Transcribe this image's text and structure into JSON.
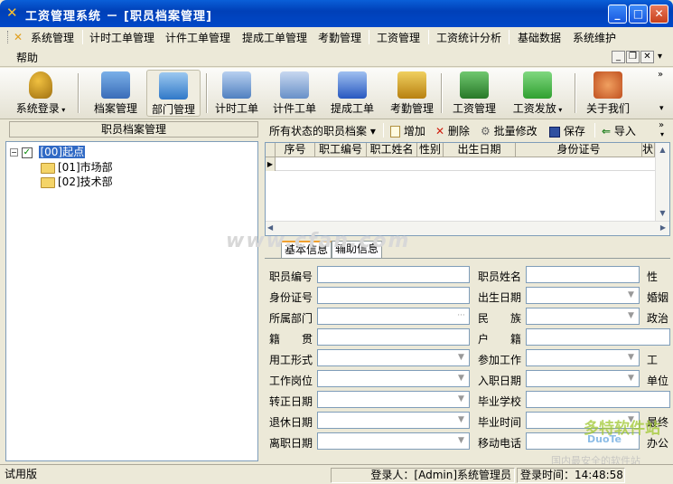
{
  "window": {
    "title": "工资管理系统 － [职员档案管理]"
  },
  "menu": [
    "系统管理",
    "计时工单管理",
    "计件工单管理",
    "提成工单管理",
    "考勤管理",
    "工资管理",
    "工资统计分析",
    "基础数据",
    "系统维护"
  ],
  "menu2": {
    "help": "帮助"
  },
  "toolbar": [
    "系统登录",
    "档案管理",
    "部门管理",
    "计时工单",
    "计件工单",
    "提成工单",
    "考勤管理",
    "工资管理",
    "工资发放",
    "关于我们"
  ],
  "left": {
    "header": "职员档案管理",
    "tree": [
      "[00]起点",
      "[01]市场部",
      "[02]技术部"
    ]
  },
  "right_toolbar": {
    "filter": "所有状态的职员档案",
    "add": "增加",
    "delete": "删除",
    "batch": "批量修改",
    "save": "保存",
    "import": "导入"
  },
  "grid": {
    "columns": [
      "序号",
      "职工编号",
      "职工姓名",
      "性别",
      "出生日期",
      "身份证号",
      "状"
    ]
  },
  "tabs": [
    "基本信息",
    "辅助信息"
  ],
  "form": {
    "labels_left": [
      "职员编号",
      "身份证号",
      "所属部门",
      "籍　　贯",
      "用工形式",
      "工作岗位",
      "转正日期",
      "退休日期",
      "离职日期"
    ],
    "labels_mid": [
      "职员姓名",
      "出生日期",
      "民　　族",
      "户　　籍",
      "参加工作",
      "入职日期",
      "毕业学校",
      "毕业时间",
      "移动电话"
    ],
    "labels_right": [
      "性",
      "婚姻",
      "政治",
      "",
      "工",
      "单位",
      "",
      "最终",
      "办公"
    ]
  },
  "status": {
    "mode": "试用版",
    "login": "登录人：[Admin]系统管理员",
    "time": "登录时间：14:48:58"
  },
  "watermark": {
    "site": "www.cfan.com",
    "brand": "多特软件站",
    "brand_sub": "DuoTe",
    "slogan": "国内最安全的软件站"
  }
}
